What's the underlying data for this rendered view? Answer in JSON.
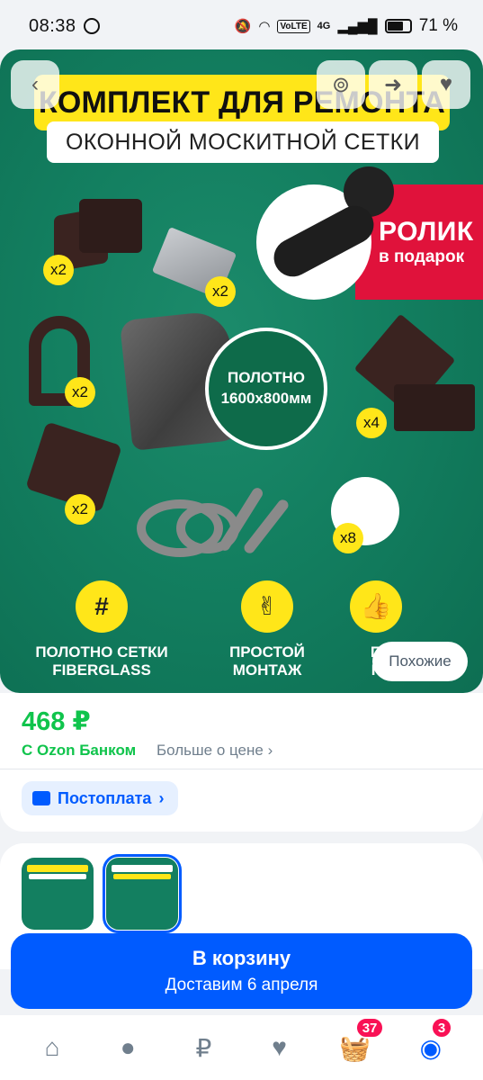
{
  "status_bar": {
    "time": "08:38",
    "battery": "71 %",
    "network": "4G",
    "volte": "VoLTE",
    "battery_level": 0.71
  },
  "hero": {
    "title": "КОМПЛЕКТ ДЛЯ РЕМОНТА",
    "subtitle": "ОКОННОЙ МОСКИТНОЙ СЕТКИ",
    "promo_line1": "РОЛИК",
    "promo_line2": "в подарок",
    "canvas_line1": "ПОЛОТНО",
    "canvas_line2": "1600x800мм",
    "counts": [
      "x2",
      "x2",
      "x2",
      "x4",
      "x2",
      "x8"
    ],
    "features": [
      {
        "line1": "ПОЛОТНО СЕТКИ",
        "line2": "FIBERGLASS",
        "icon": "grid-icon"
      },
      {
        "line1": "ПРОСТОЙ",
        "line2": "МОНТАЖ",
        "icon": "ok-hand-icon"
      },
      {
        "line1": "П",
        "line2": "К",
        "icon": "thumbs-up-icon"
      }
    ],
    "similar_label": "Похожие"
  },
  "price": {
    "value": "468 ₽",
    "bank_label": "С Ozon Банком",
    "more_label": "Больше о цене",
    "postpay_label": "Постоплата"
  },
  "cart": {
    "label": "В корзину",
    "delivery": "Доставим 6 апреля"
  },
  "tabbar": {
    "cart_badge": "37",
    "profile_badge": "3",
    "items": [
      "home-icon",
      "apple-icon",
      "ruble-icon",
      "heart-icon",
      "basket-icon",
      "profile-icon"
    ]
  },
  "colors": {
    "accent": "#005bff",
    "price_green": "#10c44c",
    "hero_green": "#137f60",
    "hero_yellow": "#ffe619",
    "promo_red": "#e0123b",
    "badge_pink": "#f91155"
  }
}
